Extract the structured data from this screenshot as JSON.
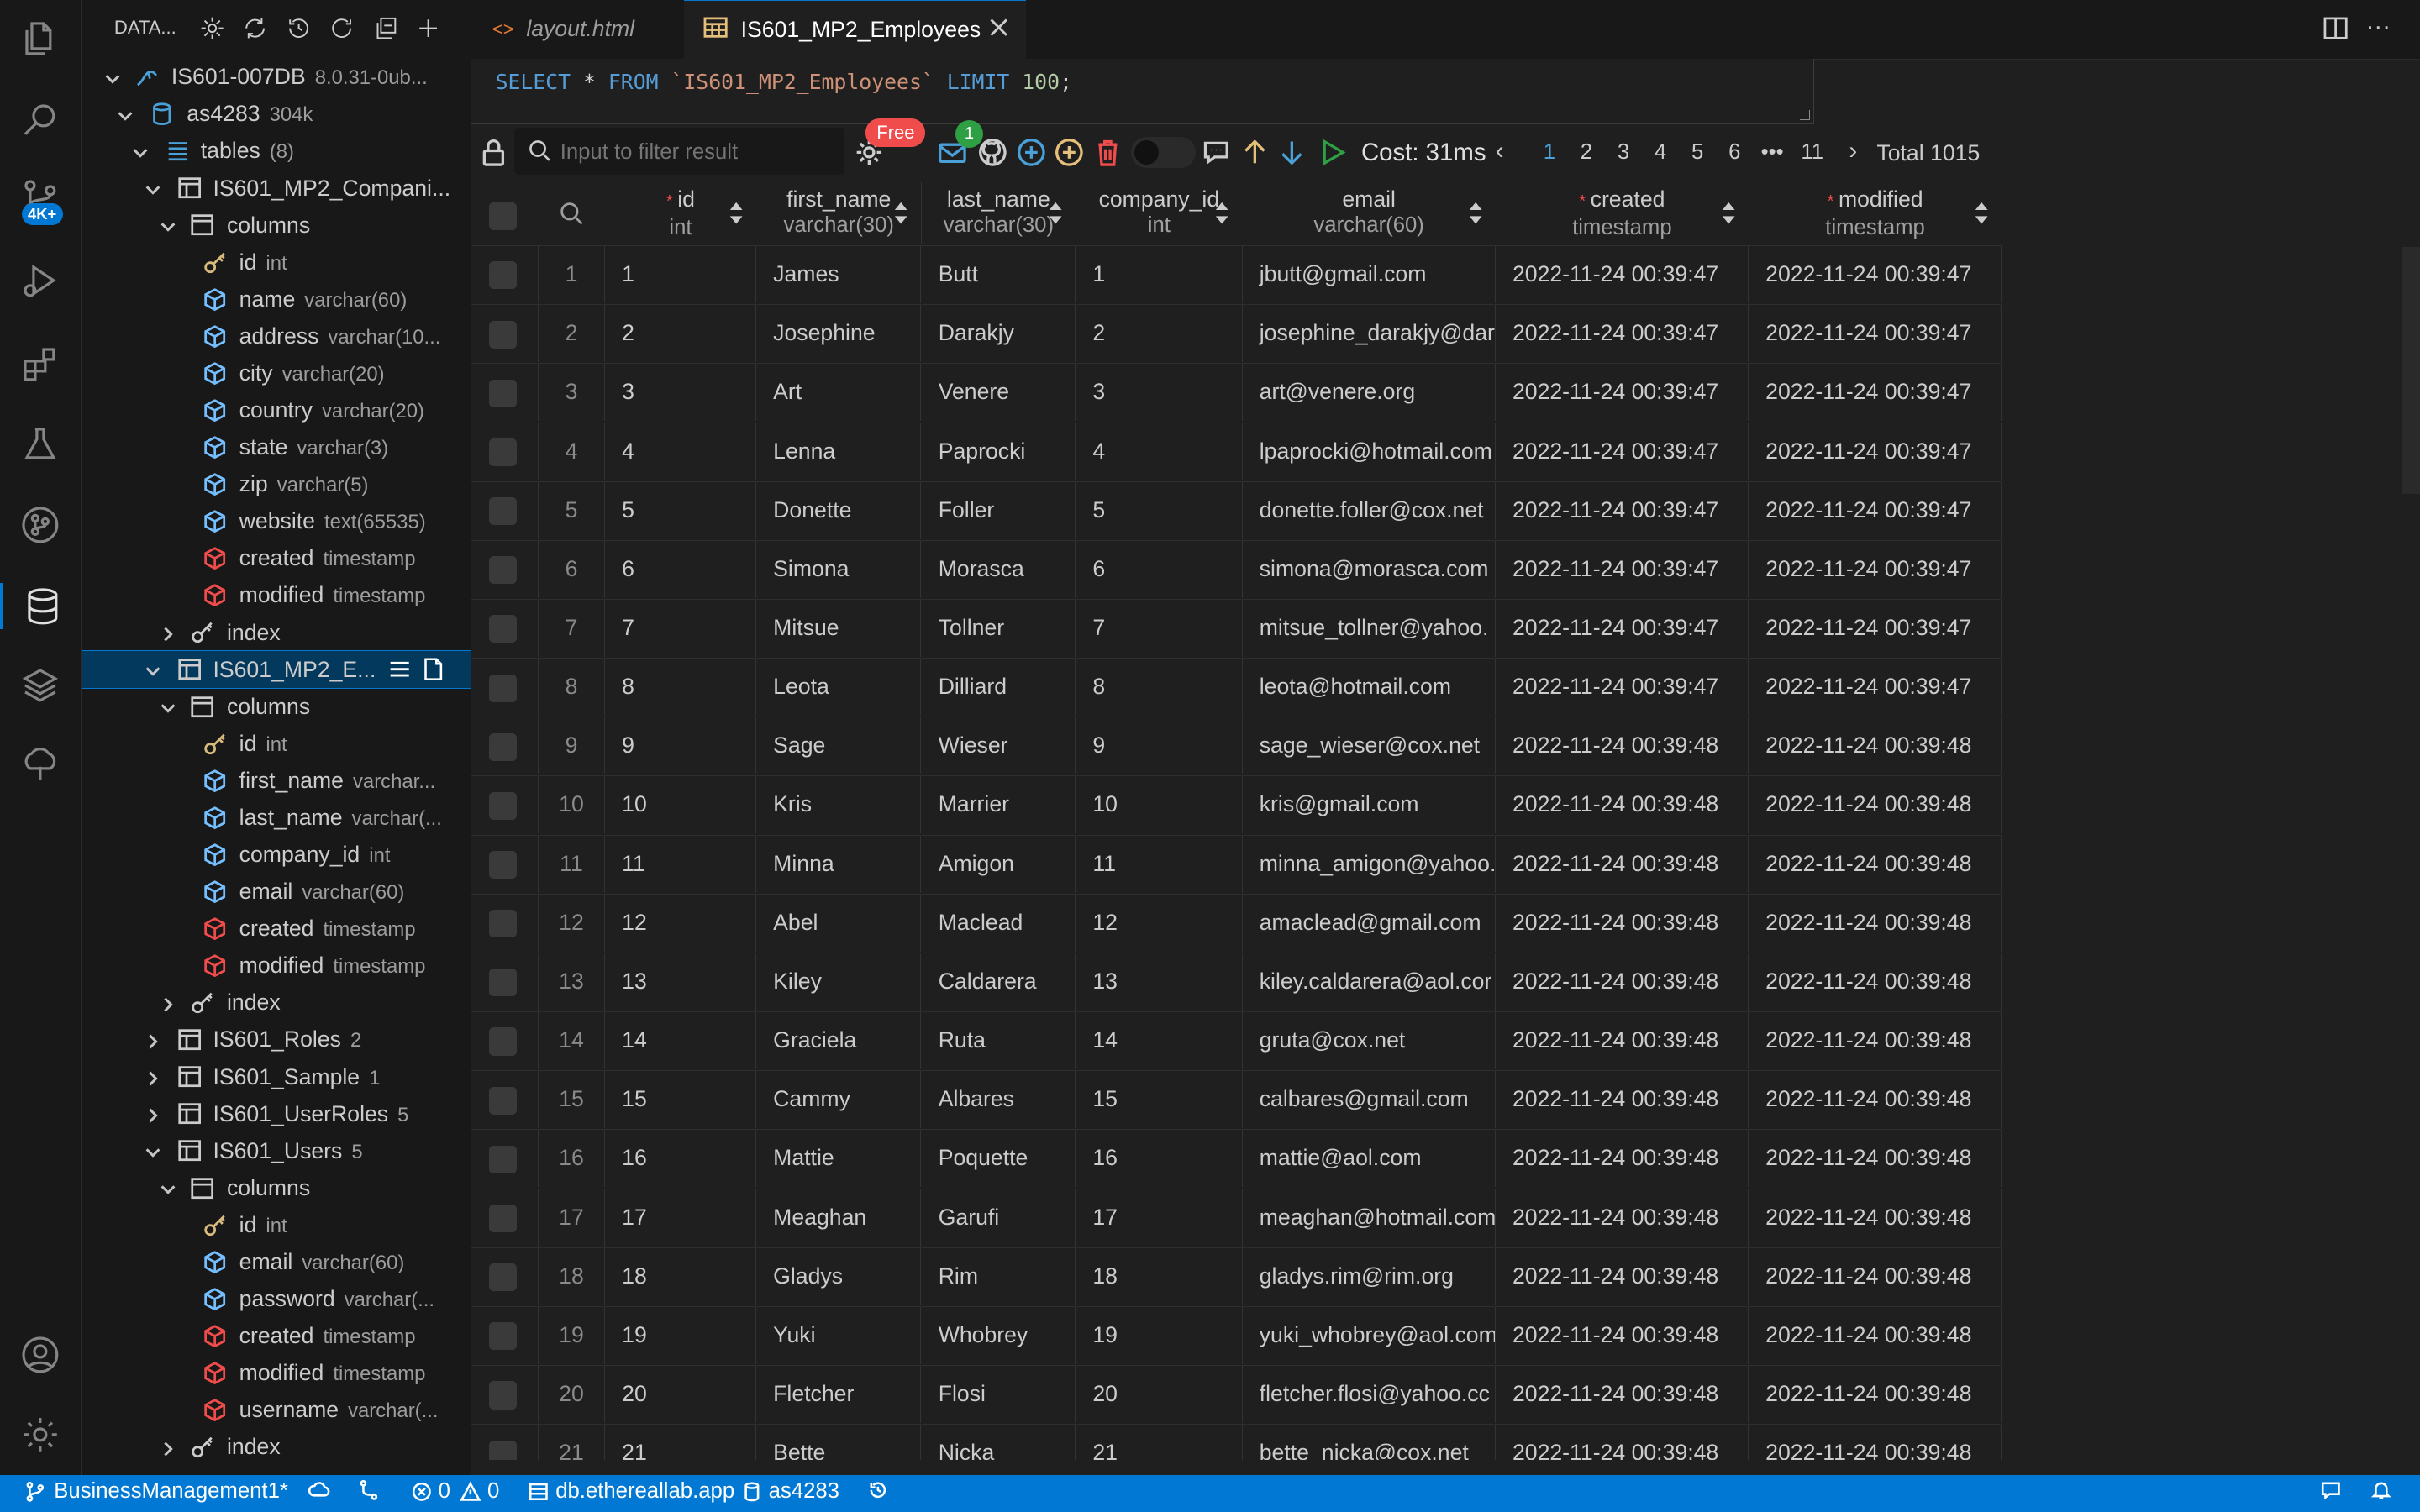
{
  "sidebar": {
    "title": "DATA...",
    "connection": {
      "label": "IS601-007DB",
      "version": "8.0.31-0ub..."
    },
    "schema": {
      "label": "as4283",
      "size": "304k"
    },
    "tables_group": {
      "label": "tables",
      "count": "(8)"
    },
    "tree": [
      {
        "label": "IS601_MP2_Compani...",
        "kind": "table"
      },
      {
        "label": "columns",
        "kind": "folder"
      },
      {
        "label": "id",
        "type": "int",
        "kind": "pk"
      },
      {
        "label": "name",
        "type": "varchar(60)",
        "kind": "col"
      },
      {
        "label": "address",
        "type": "varchar(10...",
        "kind": "col"
      },
      {
        "label": "city",
        "type": "varchar(20)",
        "kind": "col"
      },
      {
        "label": "country",
        "type": "varchar(20)",
        "kind": "col"
      },
      {
        "label": "state",
        "type": "varchar(3)",
        "kind": "col"
      },
      {
        "label": "zip",
        "type": "varchar(5)",
        "kind": "col"
      },
      {
        "label": "website",
        "type": "text(65535)",
        "kind": "col"
      },
      {
        "label": "created",
        "type": "timestamp",
        "kind": "req"
      },
      {
        "label": "modified",
        "type": "timestamp",
        "kind": "req"
      },
      {
        "label": "index",
        "kind": "index"
      },
      {
        "label": "IS601_MP2_E...",
        "kind": "table-selected"
      },
      {
        "label": "columns",
        "kind": "folder"
      },
      {
        "label": "id",
        "type": "int",
        "kind": "pk"
      },
      {
        "label": "first_name",
        "type": "varchar...",
        "kind": "col"
      },
      {
        "label": "last_name",
        "type": "varchar(...",
        "kind": "col"
      },
      {
        "label": "company_id",
        "type": "int",
        "kind": "col"
      },
      {
        "label": "email",
        "type": "varchar(60)",
        "kind": "col"
      },
      {
        "label": "created",
        "type": "timestamp",
        "kind": "req"
      },
      {
        "label": "modified",
        "type": "timestamp",
        "kind": "req"
      },
      {
        "label": "index",
        "kind": "index"
      },
      {
        "label": "IS601_Roles",
        "count": "2",
        "kind": "table-collapsed"
      },
      {
        "label": "IS601_Sample",
        "count": "1",
        "kind": "table-collapsed"
      },
      {
        "label": "IS601_UserRoles",
        "count": "5",
        "kind": "table-collapsed"
      },
      {
        "label": "IS601_Users",
        "count": "5",
        "kind": "table"
      },
      {
        "label": "columns",
        "kind": "folder"
      },
      {
        "label": "id",
        "type": "int",
        "kind": "pk"
      },
      {
        "label": "email",
        "type": "varchar(60)",
        "kind": "col"
      },
      {
        "label": "password",
        "type": "varchar(...",
        "kind": "col"
      },
      {
        "label": "created",
        "type": "timestamp",
        "kind": "req"
      },
      {
        "label": "modified",
        "type": "timestamp",
        "kind": "req"
      },
      {
        "label": "username",
        "type": "varchar(...",
        "kind": "req"
      },
      {
        "label": "index",
        "kind": "index"
      }
    ]
  },
  "activity_badge": "4K+",
  "tabs": [
    {
      "label": "layout.html",
      "active": false
    },
    {
      "label": "IS601_MP2_Employees",
      "active": true
    }
  ],
  "query": {
    "kw1": "SELECT",
    "star": "*",
    "kw2": "FROM",
    "table": "`IS601_MP2_Employees`",
    "kw3": "LIMIT",
    "limit": "100",
    "semi": ";"
  },
  "toolbar": {
    "filter_placeholder": "Input to filter result",
    "free_badge": "Free",
    "mail_badge": "1",
    "cost": "Cost: 31ms",
    "pages": [
      "1",
      "2",
      "3",
      "4",
      "5",
      "6",
      "•••",
      "11"
    ],
    "current_page": "1",
    "total": "Total 1015"
  },
  "grid": {
    "columns": [
      {
        "name": "id",
        "type": "int",
        "required": true
      },
      {
        "name": "first_name",
        "type": "varchar(30)",
        "required": false
      },
      {
        "name": "last_name",
        "type": "varchar(30)",
        "required": false
      },
      {
        "name": "company_id",
        "type": "int",
        "required": false
      },
      {
        "name": "email",
        "type": "varchar(60)",
        "required": false
      },
      {
        "name": "created",
        "type": "timestamp",
        "required": true
      },
      {
        "name": "modified",
        "type": "timestamp",
        "required": true
      }
    ],
    "rows": [
      [
        "1",
        "1",
        "James",
        "Butt",
        "1",
        "jbutt@gmail.com",
        "2022-11-24 00:39:47",
        "2022-11-24 00:39:47"
      ],
      [
        "2",
        "2",
        "Josephine",
        "Darakjy",
        "2",
        "josephine_darakjy@dar",
        "2022-11-24 00:39:47",
        "2022-11-24 00:39:47"
      ],
      [
        "3",
        "3",
        "Art",
        "Venere",
        "3",
        "art@venere.org",
        "2022-11-24 00:39:47",
        "2022-11-24 00:39:47"
      ],
      [
        "4",
        "4",
        "Lenna",
        "Paprocki",
        "4",
        "lpaprocki@hotmail.com",
        "2022-11-24 00:39:47",
        "2022-11-24 00:39:47"
      ],
      [
        "5",
        "5",
        "Donette",
        "Foller",
        "5",
        "donette.foller@cox.net",
        "2022-11-24 00:39:47",
        "2022-11-24 00:39:47"
      ],
      [
        "6",
        "6",
        "Simona",
        "Morasca",
        "6",
        "simona@morasca.com",
        "2022-11-24 00:39:47",
        "2022-11-24 00:39:47"
      ],
      [
        "7",
        "7",
        "Mitsue",
        "Tollner",
        "7",
        "mitsue_tollner@yahoo.",
        "2022-11-24 00:39:47",
        "2022-11-24 00:39:47"
      ],
      [
        "8",
        "8",
        "Leota",
        "Dilliard",
        "8",
        "leota@hotmail.com",
        "2022-11-24 00:39:47",
        "2022-11-24 00:39:47"
      ],
      [
        "9",
        "9",
        "Sage",
        "Wieser",
        "9",
        "sage_wieser@cox.net",
        "2022-11-24 00:39:48",
        "2022-11-24 00:39:48"
      ],
      [
        "10",
        "10",
        "Kris",
        "Marrier",
        "10",
        "kris@gmail.com",
        "2022-11-24 00:39:48",
        "2022-11-24 00:39:48"
      ],
      [
        "11",
        "11",
        "Minna",
        "Amigon",
        "11",
        "minna_amigon@yahoo.",
        "2022-11-24 00:39:48",
        "2022-11-24 00:39:48"
      ],
      [
        "12",
        "12",
        "Abel",
        "Maclead",
        "12",
        "amaclead@gmail.com",
        "2022-11-24 00:39:48",
        "2022-11-24 00:39:48"
      ],
      [
        "13",
        "13",
        "Kiley",
        "Caldarera",
        "13",
        "kiley.caldarera@aol.cor",
        "2022-11-24 00:39:48",
        "2022-11-24 00:39:48"
      ],
      [
        "14",
        "14",
        "Graciela",
        "Ruta",
        "14",
        "gruta@cox.net",
        "2022-11-24 00:39:48",
        "2022-11-24 00:39:48"
      ],
      [
        "15",
        "15",
        "Cammy",
        "Albares",
        "15",
        "calbares@gmail.com",
        "2022-11-24 00:39:48",
        "2022-11-24 00:39:48"
      ],
      [
        "16",
        "16",
        "Mattie",
        "Poquette",
        "16",
        "mattie@aol.com",
        "2022-11-24 00:39:48",
        "2022-11-24 00:39:48"
      ],
      [
        "17",
        "17",
        "Meaghan",
        "Garufi",
        "17",
        "meaghan@hotmail.com",
        "2022-11-24 00:39:48",
        "2022-11-24 00:39:48"
      ],
      [
        "18",
        "18",
        "Gladys",
        "Rim",
        "18",
        "gladys.rim@rim.org",
        "2022-11-24 00:39:48",
        "2022-11-24 00:39:48"
      ],
      [
        "19",
        "19",
        "Yuki",
        "Whobrey",
        "19",
        "yuki_whobrey@aol.com",
        "2022-11-24 00:39:48",
        "2022-11-24 00:39:48"
      ],
      [
        "20",
        "20",
        "Fletcher",
        "Flosi",
        "20",
        "fletcher.flosi@yahoo.cc",
        "2022-11-24 00:39:48",
        "2022-11-24 00:39:48"
      ],
      [
        "21",
        "21",
        "Bette",
        "Nicka",
        "21",
        "bette_nicka@cox.net",
        "2022-11-24 00:39:48",
        "2022-11-24 00:39:48"
      ]
    ]
  },
  "status": {
    "branch": "BusinessManagement1*",
    "errors": "0",
    "warnings": "0",
    "host": "db.ethereallab.app",
    "db": "as4283"
  },
  "colors": {
    "accent": "#0078d4",
    "key_icon": "#d7ba7d",
    "col_icon": "#75beff",
    "req_icon": "#f14c4c",
    "sql_keyword": "#569cd6",
    "sql_string": "#ce9178",
    "sql_number": "#b5cea8"
  }
}
